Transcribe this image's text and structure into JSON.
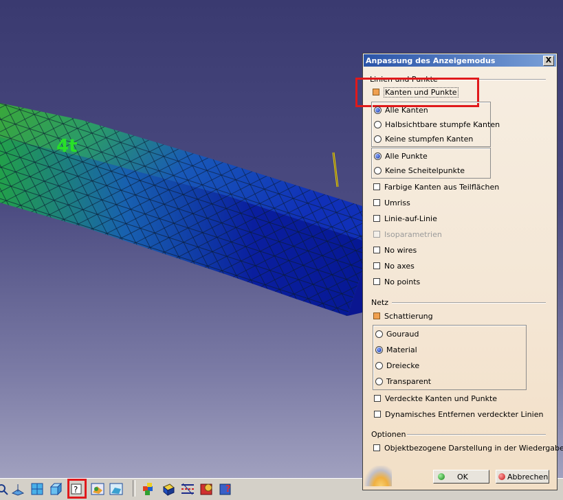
{
  "dialog": {
    "title": "Anpassung des Anzeigemodus",
    "close_label": "X",
    "sections": {
      "lines_points": "Linien und Punkte",
      "mesh": "Netz",
      "options": "Optionen"
    },
    "edges_points_toggle": "Kanten und Punkte",
    "edge_modes": [
      "Alle Kanten",
      "Halbsichtbare stumpfe Kanten",
      "Keine stumpfen Kanten"
    ],
    "point_modes": [
      "Alle Punkte",
      "Keine Scheitelpunkte"
    ],
    "line_checks": [
      "Farbige Kanten aus Teilflächen",
      "Umriss",
      "Linie-auf-Linie",
      "Isoparametrien",
      "No wires",
      "No axes",
      "No points"
    ],
    "shading_toggle": "Schattierung",
    "shading_modes": [
      "Gouraud",
      "Material",
      "Dreiecke",
      "Transparent"
    ],
    "mesh_checks": [
      "Verdeckte Kanten und Punkte",
      "Dynamisches Entfernen verdeckter Linien"
    ],
    "option_checks": [
      "Objektbezogene Darstellung in der Wiedergabe"
    ],
    "ok_label": "OK",
    "cancel_label": "Abbrechen"
  },
  "viewport": {
    "compass_label": "4t"
  },
  "toolbar": {
    "icons": [
      "zoom-icon",
      "plane-icon",
      "grid-view-icon",
      "cube-view-icon",
      "custom-view-mode-icon",
      "render-style-icon",
      "shading-icon",
      "color-cube-icon",
      "material-icon",
      "edges-icon",
      "apply-material-icon",
      "question-icon"
    ]
  },
  "colors": {
    "highlight": "#e0191b",
    "title_bar": "#2a54a8",
    "viewport_bg": "#3a3a70"
  }
}
